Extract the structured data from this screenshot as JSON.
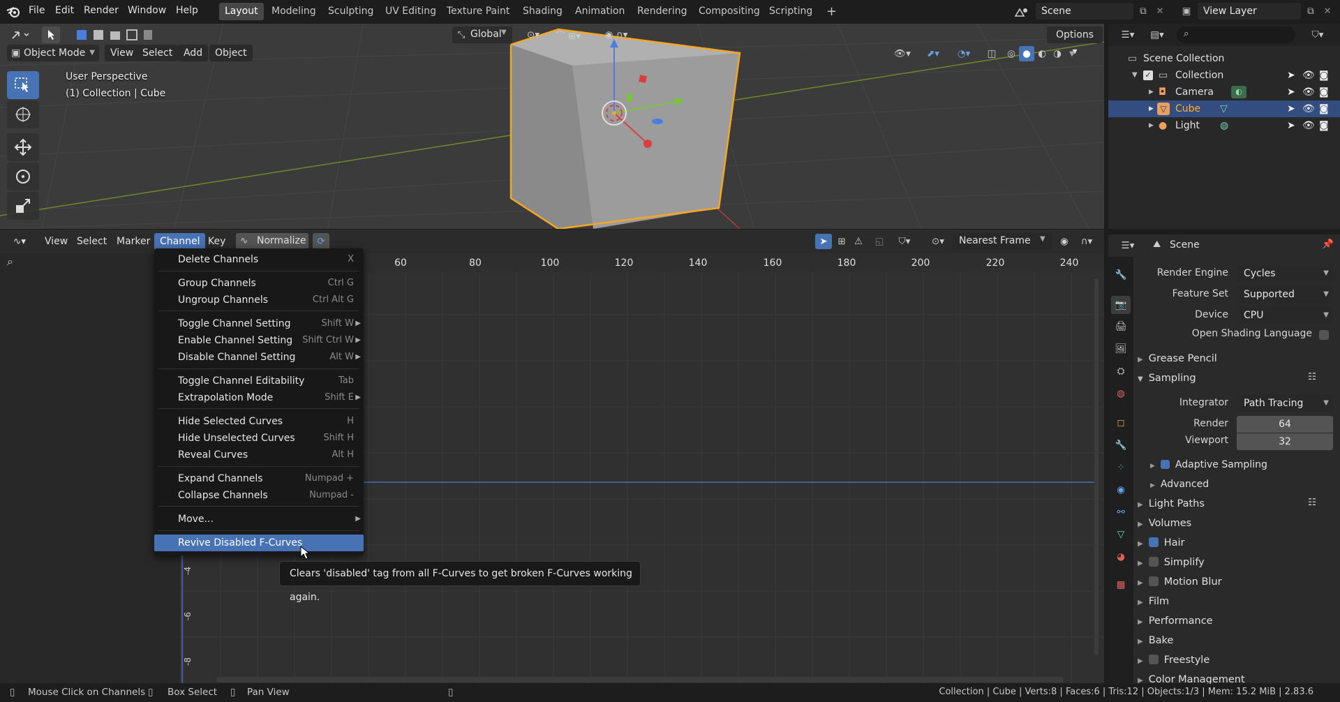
{
  "topbar": {
    "menus": [
      "File",
      "Edit",
      "Render",
      "Window",
      "Help"
    ],
    "workspaces": [
      "Layout",
      "Modeling",
      "Sculpting",
      "UV Editing",
      "Texture Paint",
      "Shading",
      "Animation",
      "Rendering",
      "Compositing",
      "Scripting"
    ],
    "active_workspace": "Layout",
    "add_tab": "+",
    "scene": "Scene",
    "view_layer": "View Layer"
  },
  "viewport": {
    "mode": "Object Mode",
    "menus": [
      "View",
      "Select",
      "Add",
      "Object"
    ],
    "orientation": "Global",
    "options": "Options",
    "title": "User Perspective",
    "subtitle": "(1) Collection | Cube"
  },
  "graph": {
    "menus": [
      "View",
      "Select",
      "Marker",
      "Channel",
      "Key"
    ],
    "active_menu": "Channel",
    "normalize": "Normalize",
    "snap": "Nearest Frame",
    "ruler": [
      "60",
      "80",
      "100",
      "120",
      "140",
      "160",
      "180",
      "200",
      "220",
      "240"
    ],
    "y_labels": [
      "-4",
      "-6",
      "-8"
    ]
  },
  "channel_menu": {
    "items": [
      {
        "label": "Delete Channels",
        "shortcut": "X"
      },
      {
        "label": "Group Channels",
        "shortcut": "Ctrl G"
      },
      {
        "label": "Ungroup Channels",
        "shortcut": "Ctrl Alt G"
      },
      {
        "label": "Toggle Channel Setting",
        "shortcut": "Shift W"
      },
      {
        "label": "Enable Channel Setting",
        "shortcut": "Shift Ctrl W"
      },
      {
        "label": "Disable Channel Setting",
        "shortcut": "Alt W"
      },
      {
        "label": "Toggle Channel Editability",
        "shortcut": "Tab"
      },
      {
        "label": "Extrapolation Mode",
        "shortcut": "Shift E"
      },
      {
        "label": "Hide Selected Curves",
        "shortcut": "H"
      },
      {
        "label": "Hide Unselected Curves",
        "shortcut": "Shift H"
      },
      {
        "label": "Reveal Curves",
        "shortcut": "Alt H"
      },
      {
        "label": "Expand Channels",
        "shortcut": "Numpad +"
      },
      {
        "label": "Collapse Channels",
        "shortcut": "Numpad -"
      },
      {
        "label": "Move...",
        "shortcut": ""
      },
      {
        "label": "Revive Disabled F-Curves",
        "shortcut": ""
      }
    ],
    "tooltip": "Clears 'disabled' tag from all F-Curves to get broken F-Curves working again."
  },
  "outliner": {
    "root": "Scene Collection",
    "collection": "Collection",
    "objects": [
      "Camera",
      "Cube",
      "Light"
    ],
    "selected": "Cube"
  },
  "properties": {
    "context": "Scene",
    "render_engine_label": "Render Engine",
    "render_engine": "Cycles",
    "feature_set_label": "Feature Set",
    "feature_set": "Supported",
    "device_label": "Device",
    "device": "CPU",
    "osl": "Open Shading Language",
    "grease_pencil": "Grease Pencil",
    "sampling": "Sampling",
    "integrator_label": "Integrator",
    "integrator": "Path Tracing",
    "render_label": "Render",
    "render_samples": "64",
    "viewport_label": "Viewport",
    "viewport_samples": "32",
    "adaptive": "Adaptive Sampling",
    "advanced": "Advanced",
    "sections": [
      "Light Paths",
      "Volumes",
      "Hair",
      "Simplify",
      "Motion Blur",
      "Film",
      "Performance",
      "Bake",
      "Freestyle",
      "Color Management"
    ]
  },
  "status": {
    "left1": "Mouse Click on Channels",
    "left2": "Box Select",
    "left3": "Pan View",
    "right": "Collection | Cube | Verts:8 | Faces:6 | Tris:12 | Objects:1/3 | Mem: 15.2 MiB | 2.83.6"
  },
  "colors": {
    "accent": "#4772b3",
    "selection_orange": "#f5a623",
    "bg": "#1d1d1d"
  }
}
